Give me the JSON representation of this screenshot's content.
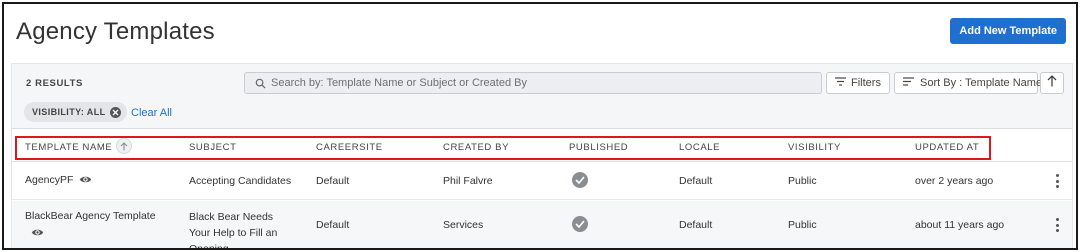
{
  "header": {
    "title": "Agency Templates",
    "add_button_label": "Add New Template"
  },
  "toolbar": {
    "results_count": "2 RESULTS",
    "search_placeholder": "Search by: Template Name or Subject or Created By",
    "filters_label": "Filters",
    "sort_label": "Sort By : Template Name",
    "filter_chip_label": "VISIBILITY: ALL",
    "clear_all_label": "Clear All"
  },
  "table": {
    "columns": [
      "TEMPLATE NAME",
      "SUBJECT",
      "CAREERSITE",
      "CREATED BY",
      "PUBLISHED",
      "LOCALE",
      "VISIBILITY",
      "UPDATED AT"
    ],
    "rows": [
      {
        "template_name": "AgencyPF",
        "subject": "Accepting Candidates",
        "careersite": "Default",
        "created_by": "Phil Falvre",
        "published": true,
        "locale": "Default",
        "visibility": "Public",
        "updated_at": "over 2 years ago"
      },
      {
        "template_name": "BlackBear Agency Template",
        "subject": "Black Bear Needs Your Help to Fill an Opening",
        "careersite": "Default",
        "created_by": "Services",
        "published": true,
        "locale": "Default",
        "visibility": "Public",
        "updated_at": "about 11 years ago"
      }
    ]
  },
  "colors": {
    "accent": "#1f6fd1",
    "highlight": "#e0161a",
    "published_check": "#8a8d91"
  },
  "icons": {
    "search": "search-icon",
    "filters": "filter-lines-icon",
    "sort": "sort-lines-icon",
    "sort_direction": "arrow-up-icon",
    "chip_close": "close-circle-icon",
    "column_sort": "arrow-up-icon",
    "visible": "eye-icon",
    "published": "check-circle-icon",
    "row_menu": "kebab-menu-icon"
  }
}
